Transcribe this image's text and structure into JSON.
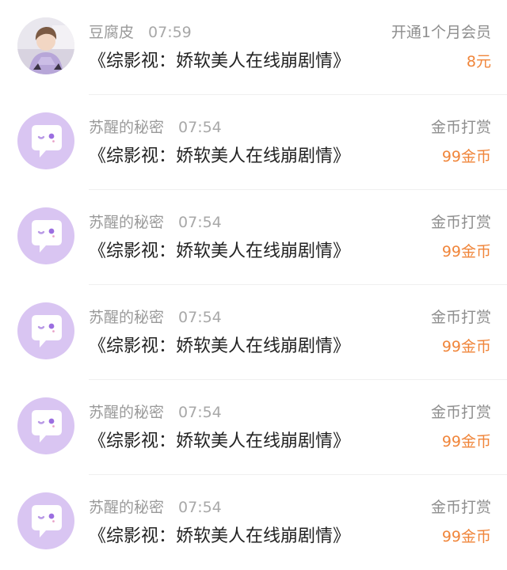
{
  "colors": {
    "accent_orange": "#f0853a",
    "avatar_purple": "#d9c5f2",
    "muted_text": "#9a9a9a",
    "primary_text": "#222222"
  },
  "records": [
    {
      "user": "豆腐皮",
      "time": "07:59",
      "title": "《综影视：娇软美人在线崩剧情》",
      "type": "开通1个月会员",
      "amount": "8元",
      "avatar": "photo-avatar"
    },
    {
      "user": "苏醒的秘密",
      "time": "07:54",
      "title": "《综影视：娇软美人在线崩剧情》",
      "type": "金币打赏",
      "amount": "99金币",
      "avatar": "default-avatar-chat-icon"
    },
    {
      "user": "苏醒的秘密",
      "time": "07:54",
      "title": "《综影视：娇软美人在线崩剧情》",
      "type": "金币打赏",
      "amount": "99金币",
      "avatar": "default-avatar-chat-icon"
    },
    {
      "user": "苏醒的秘密",
      "time": "07:54",
      "title": "《综影视：娇软美人在线崩剧情》",
      "type": "金币打赏",
      "amount": "99金币",
      "avatar": "default-avatar-chat-icon"
    },
    {
      "user": "苏醒的秘密",
      "time": "07:54",
      "title": "《综影视：娇软美人在线崩剧情》",
      "type": "金币打赏",
      "amount": "99金币",
      "avatar": "default-avatar-chat-icon"
    },
    {
      "user": "苏醒的秘密",
      "time": "07:54",
      "title": "《综影视：娇软美人在线崩剧情》",
      "type": "金币打赏",
      "amount": "99金币",
      "avatar": "default-avatar-chat-icon"
    }
  ]
}
